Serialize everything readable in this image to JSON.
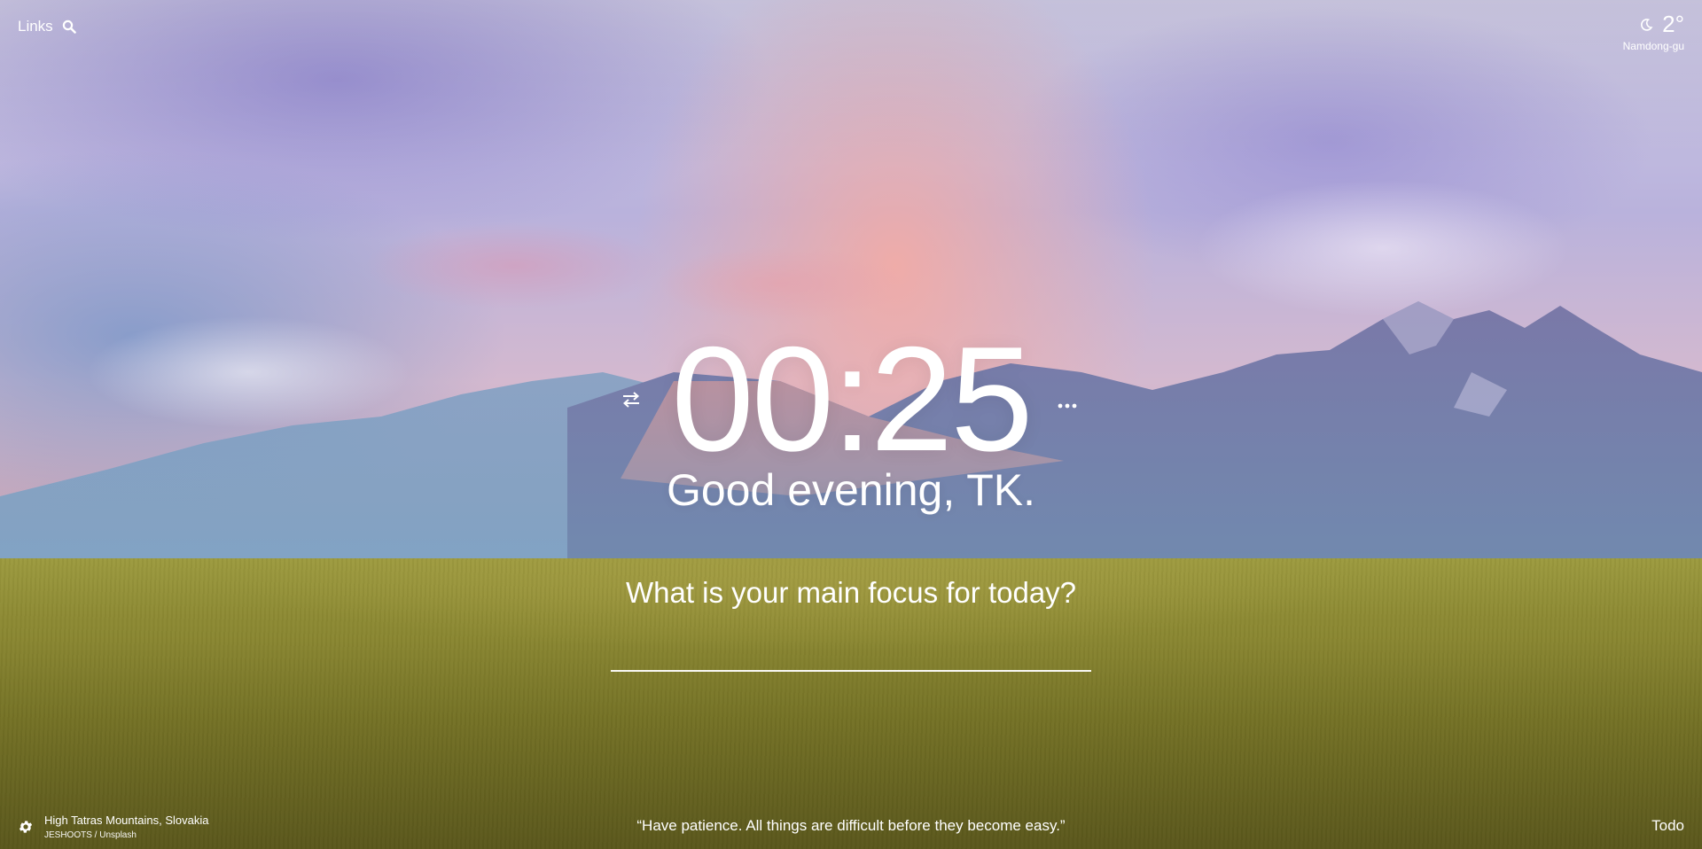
{
  "background": {
    "photo_title": "High Tatras Mountains, Slovakia",
    "photo_credit": "JESHOOTS / Unsplash"
  },
  "header": {
    "links_label": "Links",
    "search_icon": "search-icon"
  },
  "weather": {
    "icon": "moon-icon",
    "temperature": "2°",
    "location": "Namdong-gu"
  },
  "clock": {
    "time": "00:25",
    "swap_icon": "swap-icon",
    "more_icon": "more-icon"
  },
  "greeting": "Good evening, TK.",
  "focus": {
    "question": "What is your main focus for today?",
    "value": ""
  },
  "footer": {
    "settings_icon": "gear-icon",
    "quote": "“Have patience. All things are difficult before they become easy.”",
    "todo_label": "Todo"
  },
  "colors": {
    "text": "#ffffff"
  }
}
